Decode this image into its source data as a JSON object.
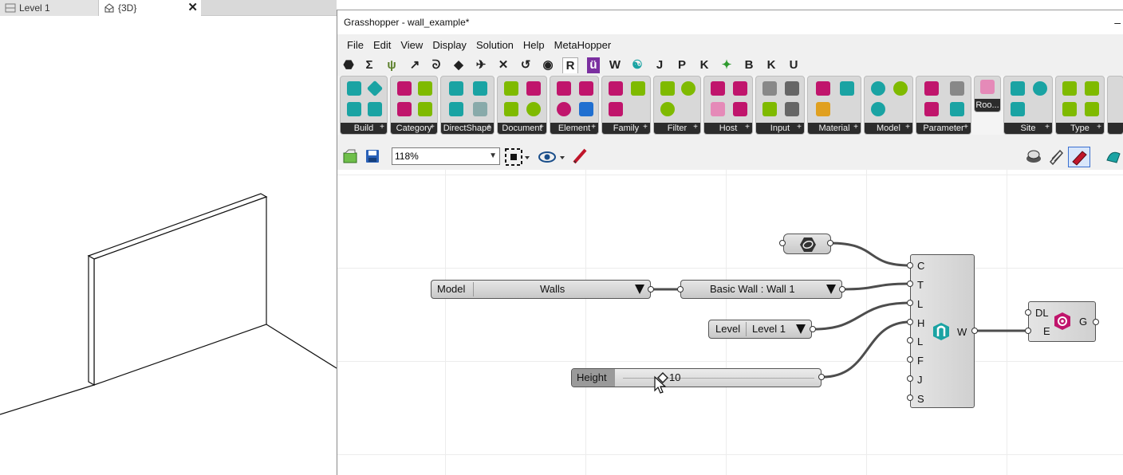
{
  "revit": {
    "tabs": [
      {
        "label": "Level 1",
        "active": false
      },
      {
        "label": "{3D}",
        "active": true
      }
    ],
    "close_glyph": "✕"
  },
  "gh": {
    "title": "Grasshopper - wall_example*",
    "minimize_glyph": "–",
    "menu": [
      "File",
      "Edit",
      "View",
      "Display",
      "Solution",
      "Help",
      "MetaHopper"
    ],
    "tabs": [
      "⬣",
      "Σ",
      "ψ",
      "↗",
      "ᘐ",
      "◆",
      "✈",
      "✕",
      "↺",
      "◉",
      "R",
      "ü",
      "W",
      "☯",
      "J",
      "P",
      "K",
      "✦",
      "B",
      "K",
      "U"
    ],
    "ribbon_panels": [
      "Build",
      "Category",
      "DirectShape",
      "Document",
      "Element",
      "Family",
      "Filter",
      "Host",
      "Input",
      "Material",
      "Model",
      "Parameter",
      "Roo...",
      "Site",
      "Type"
    ],
    "zoom": "118%",
    "nodes": {
      "pipe": {
        "icon": "pipe-icon"
      },
      "category": {
        "left": "Model",
        "right": "Walls"
      },
      "wall_type": {
        "label": "Basic Wall : Wall 1"
      },
      "level": {
        "left": "Level",
        "right": "Level 1"
      },
      "slider": {
        "label": "Height",
        "value": "10"
      },
      "wall_by_curve": {
        "inputs": [
          "C",
          "T",
          "L",
          "H",
          "L",
          "F",
          "J",
          "S"
        ],
        "output": "W"
      },
      "geometry": {
        "inputs": [
          "DL",
          "E"
        ],
        "output": "G"
      }
    },
    "colors": {
      "accent_teal": "#1aa3a3",
      "accent_magenta": "#c0156c",
      "accent_green": "#7fba00",
      "wire": "#4d4d4d"
    }
  }
}
